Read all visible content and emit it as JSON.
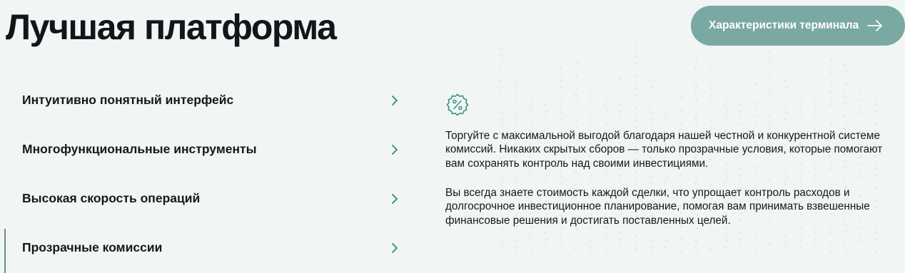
{
  "header": {
    "title": "Лучшая платформа",
    "cta_label": "Характеристики терминала",
    "cta_icon": "arrow-right-icon"
  },
  "features": {
    "items": [
      {
        "label": "Интуитивно понятный интерфейс"
      },
      {
        "label": "Многофункциональные инструменты"
      },
      {
        "label": "Высокая скорость операций"
      },
      {
        "label": "Прозрачные комиссии"
      }
    ],
    "active_index": 3
  },
  "detail": {
    "icon": "percent-badge-icon",
    "paragraph_1": "Торгуйте с максимальной выгодой благодаря нашей честной и конкурентной системе комиссий. Никаких скрытых сборов — только прозрачные условия, которые помогают вам сохранять контроль над своими инвестициями.",
    "paragraph_2": "Вы всегда знаете стоимость каждой сделки, что упрощает контроль расходов и долгосрочное инвестиционное планирование, помогая вам принимать взвешенные финансовые решения и достигать поставленных целей."
  },
  "colors": {
    "background": "#f1f6f5",
    "cta_background": "#7aa8a3",
    "accent": "#2f8a7a",
    "text": "#14181c"
  }
}
